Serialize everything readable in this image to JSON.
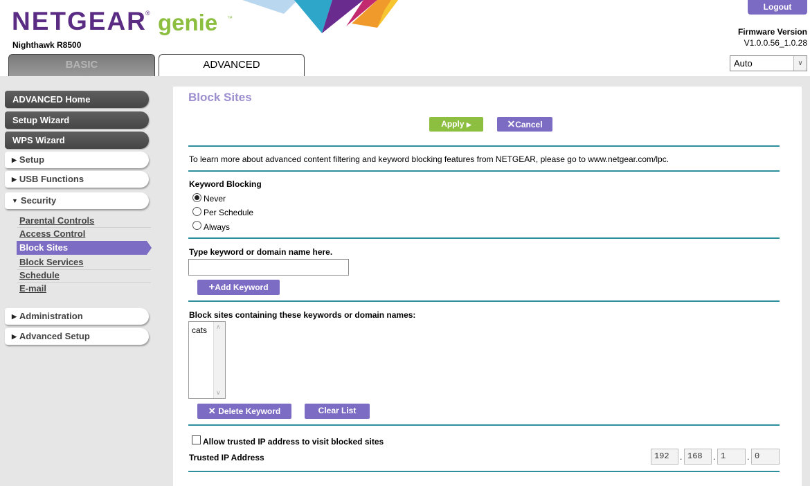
{
  "header": {
    "brand": "NETGEAR",
    "brand_mark": "®",
    "product": "genie",
    "product_mark": "™",
    "model": "Nighthawk R8500",
    "logout_label": "Logout",
    "firmware_label": "Firmware Version",
    "firmware_value": "V1.0.0.56_1.0.28",
    "language_selected": "Auto",
    "tabs": [
      {
        "label": "BASIC",
        "active": false
      },
      {
        "label": "ADVANCED",
        "active": true
      }
    ]
  },
  "sidebar": {
    "main_items": [
      "ADVANCED Home",
      "Setup Wizard",
      "WPS Wizard"
    ],
    "sections": [
      {
        "label": "Setup",
        "expanded": false
      },
      {
        "label": "USB Functions",
        "expanded": false
      },
      {
        "label": "Security",
        "expanded": true
      },
      {
        "label": "Administration",
        "expanded": false
      },
      {
        "label": "Advanced Setup",
        "expanded": false
      }
    ],
    "security_items": [
      "Parental Controls",
      "Access Control",
      "Block Sites",
      "Block Services",
      "Schedule",
      "E-mail"
    ],
    "active_item": "Block Sites"
  },
  "main": {
    "title": "Block Sites",
    "apply_label": "Apply",
    "cancel_label": "Cancel",
    "info_text": "To learn more about advanced content filtering and keyword blocking features from NETGEAR, please go to www.netgear.com/lpc.",
    "keyword_blocking_label": "Keyword Blocking",
    "radio_options": [
      {
        "label": "Never",
        "checked": true
      },
      {
        "label": "Per Schedule",
        "checked": false
      },
      {
        "label": "Always",
        "checked": false
      }
    ],
    "keyword_input_label": "Type keyword or domain name here.",
    "keyword_input_value": "",
    "add_keyword_label": "Add Keyword",
    "block_list_label": "Block sites containing these keywords or domain names:",
    "block_list": [
      "cats"
    ],
    "delete_keyword_label": "Delete Keyword",
    "clear_list_label": "Clear List",
    "allow_trusted_label": "Allow trusted IP address to visit blocked sites",
    "allow_trusted_checked": false,
    "trusted_ip_label": "Trusted IP Address",
    "trusted_ip": [
      "192",
      "168",
      "1",
      "0"
    ]
  },
  "colors": {
    "brand_purple": "#5b2c83",
    "genie_green": "#8cbe3f",
    "button_purple": "#7d6cc3",
    "button_green": "#8cbf3f",
    "divider_teal": "#2a8f9b",
    "title_lavender": "#9d8fcf"
  }
}
